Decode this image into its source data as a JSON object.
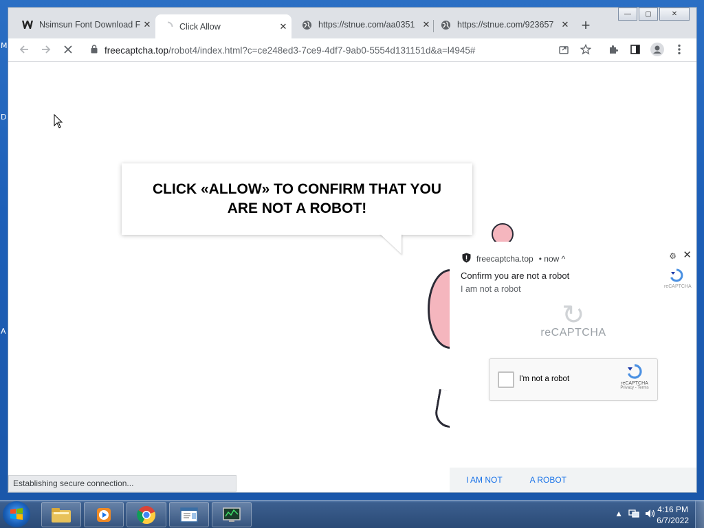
{
  "desktop": {
    "edge_letters": [
      "M",
      "D",
      "A"
    ]
  },
  "browser": {
    "tabs": [
      {
        "title": "Nsimsun Font Download F",
        "favicon": "w-logo-icon",
        "active": false
      },
      {
        "title": "Click Allow",
        "favicon": "loading-spinner-icon",
        "active": true
      },
      {
        "title": "https://stnue.com/aa0351",
        "favicon": "globe-icon",
        "active": false
      },
      {
        "title": "https://stnue.com/923657",
        "favicon": "globe-icon",
        "active": false
      }
    ],
    "new_tab": "+",
    "window_controls": {
      "minimize": "—",
      "maximize": "▢",
      "close": "✕"
    },
    "address": {
      "domain": "freecaptcha.top",
      "path": "/robot4/index.html?c=ce248ed3-7ce9-4df7-9ab0-5554d131151d&a=l4945#"
    },
    "status": "Establishing secure connection..."
  },
  "page": {
    "headline": "CLICK «ALLOW» TO CONFIRM THAT YOU ARE NOT A ROBOT!"
  },
  "notification": {
    "site": "freecaptcha.top",
    "time": "• now ^",
    "title": "Confirm you are not a robot",
    "body": "I am not a robot",
    "logo_small": "reCAPTCHA",
    "big_logo_text": "reCAPTCHA",
    "checkbox_label": "I'm not a robot",
    "captcha_logo_text": "reCAPTCHA",
    "captcha_links": "Privacy - Terms",
    "actions": [
      "I AM NOT",
      "A ROBOT"
    ]
  },
  "taskbar": {
    "clock_time": "4:16 PM",
    "clock_date": "6/7/2022"
  },
  "colors": {
    "accent": "#1a73e8",
    "taskbar": "#2a4a76",
    "desktop": "#1d5fb8"
  }
}
